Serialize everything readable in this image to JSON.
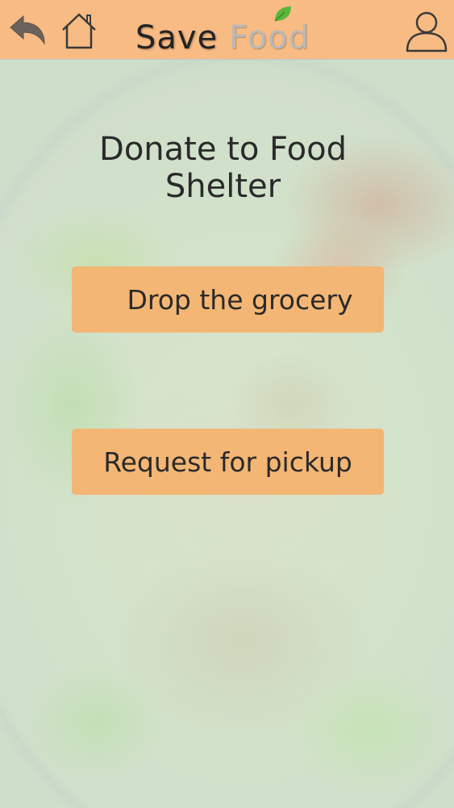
{
  "header": {
    "logo_part1": "Save",
    "logo_part2": "Food",
    "back_icon": "back-arrow-icon",
    "home_icon": "home-icon",
    "profile_icon": "user-icon"
  },
  "main": {
    "title_line1": "Donate to Food",
    "title_line2": "Shelter",
    "buttons": [
      {
        "label": "Drop the grocery"
      },
      {
        "label": "Request for pickup"
      }
    ]
  },
  "colors": {
    "header_bg": "#f8bb83",
    "button_bg": "#f3b674",
    "leaf": "#5bb63b"
  }
}
